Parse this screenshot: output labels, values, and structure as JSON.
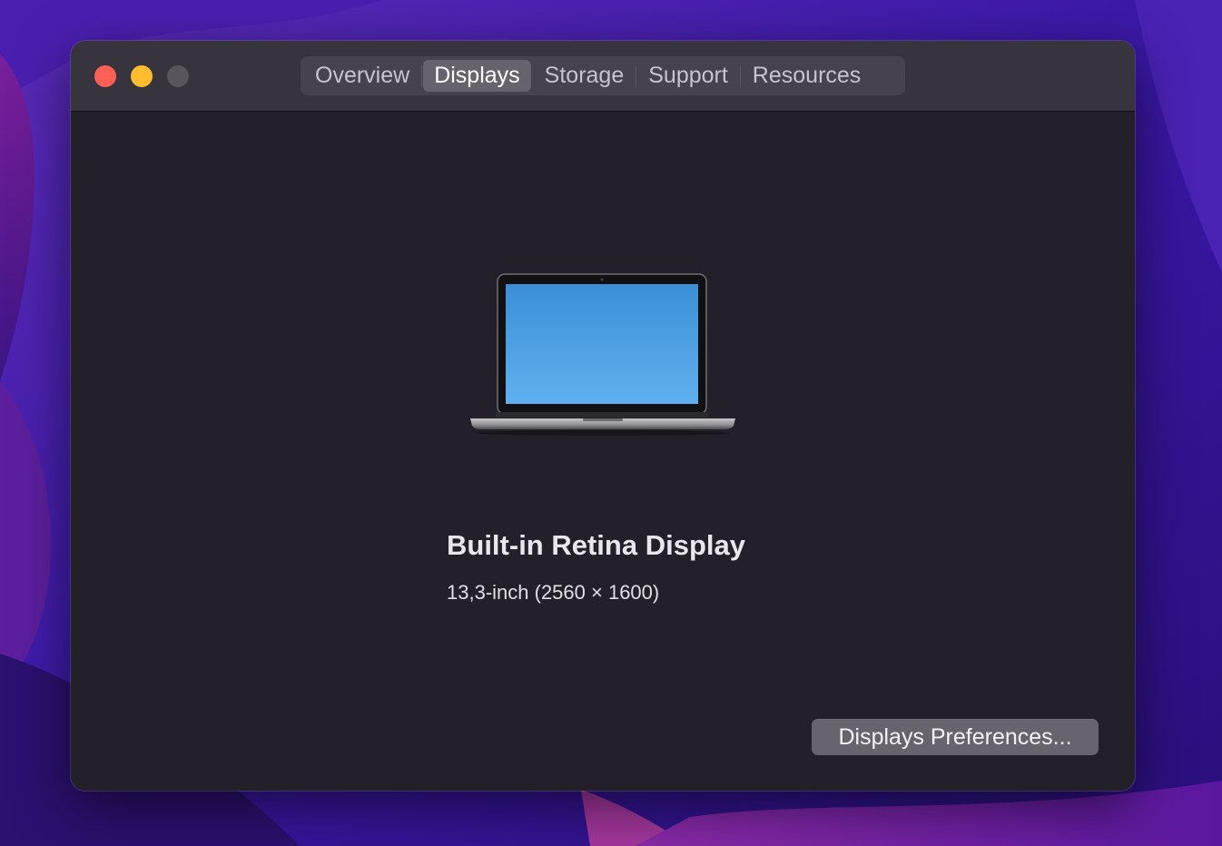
{
  "window": {
    "tabs": [
      {
        "label": "Overview"
      },
      {
        "label": "Displays"
      },
      {
        "label": "Storage"
      },
      {
        "label": "Support"
      },
      {
        "label": "Resources"
      }
    ],
    "active_tab": "Displays"
  },
  "display": {
    "name": "Built-in Retina Display",
    "spec": "13,3-inch (2560 × 1600)",
    "device_icon": "macbook-laptop-icon"
  },
  "actions": {
    "preferences_label": "Displays Preferences..."
  },
  "colors": {
    "window_bg": "#24202a",
    "titlebar_bg": "#38343d",
    "close": "#fe5f57",
    "minimize": "#febc2e",
    "zoom_disabled": "#58555c",
    "screen_blue": "#4a9ee0"
  }
}
